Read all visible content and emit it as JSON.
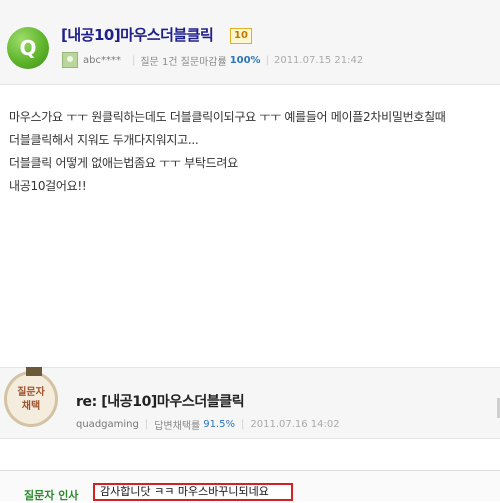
{
  "question": {
    "badge": "Q",
    "title": "[내공10]마우스더블클릭",
    "points": "10",
    "user": "abc****",
    "meta_prefix": "질문 1건 질문마감률",
    "close_rate": "100%",
    "date": "2011.07.15 21:42",
    "body_lines": [
      "마우스가요 ㅜㅜ 원클릭하는데도 더블클릭이되구요 ㅜㅜ 예를들어 메이플2차비밀번호칠때",
      "더블클릭해서 지워도 두개다지워지고...",
      "더블클릭 어떻게 없애는법좀요 ㅜㅜ 부탁드려요",
      "내공10걸어요!!"
    ]
  },
  "answer": {
    "medal_line1": "질문자",
    "medal_line2": "채택",
    "title": "re: [내공10]마우스더블클릭",
    "user": "quadgaming",
    "meta_prefix": "답변채택률",
    "adopt_rate": "91.5%",
    "date": "2011.07.16 14:02"
  },
  "greeting": {
    "label": "질문자 인사",
    "text": "감사합니닷 ㅋㅋ 마우스바꾸니되네요"
  },
  "colors": {
    "title_blue": "#1f1f8a",
    "rate_blue": "#2b76b9",
    "badge_green": "#5fb52c",
    "highlight_red": "#d22222"
  }
}
